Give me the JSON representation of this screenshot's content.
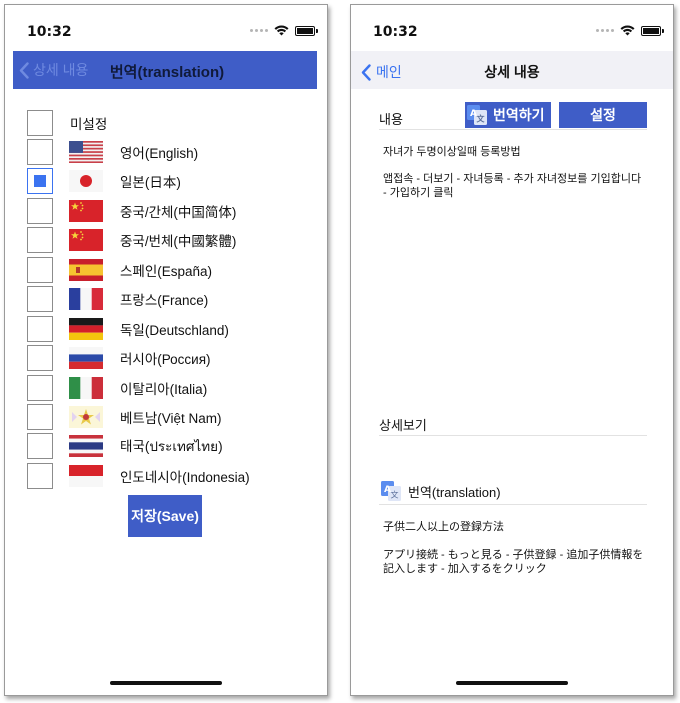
{
  "status_bar": {
    "time": "10:32"
  },
  "left_screen": {
    "nav": {
      "back_label": "상세 내용",
      "title": "번역(translation)"
    },
    "unset_label": "미설정",
    "languages": [
      {
        "label": "영어(English)",
        "flag": "us-flag",
        "checked": false
      },
      {
        "label": "일본(日本)",
        "flag": "japan-flag",
        "checked": true
      },
      {
        "label": "중국/간체(中国简体)",
        "flag": "china-flag",
        "checked": false
      },
      {
        "label": "중국/번체(中國繁體)",
        "flag": "china-flag",
        "checked": false
      },
      {
        "label": "스페인(España)",
        "flag": "spain-flag",
        "checked": false
      },
      {
        "label": "프랑스(France)",
        "flag": "france-flag",
        "checked": false
      },
      {
        "label": "독일(Deutschland)",
        "flag": "germany-flag",
        "checked": false
      },
      {
        "label": "러시아(Россия)",
        "flag": "russia-flag",
        "checked": false
      },
      {
        "label": "이탈리아(Italia)",
        "flag": "italy-flag",
        "checked": false
      },
      {
        "label": "베트남(Việt Nam)",
        "flag": "vietnam-flag",
        "checked": false
      },
      {
        "label": "태국(ประเทศไทย)",
        "flag": "thailand-flag",
        "checked": false
      },
      {
        "label": "인도네시아(Indonesia)",
        "flag": "indonesia-flag",
        "checked": false
      }
    ],
    "save_label": "저장(Save)"
  },
  "right_screen": {
    "nav": {
      "back_label": "메인",
      "title": "상세 내용"
    },
    "content_label": "내용",
    "translate_button": "번역하기",
    "settings_button": "설정",
    "content_title": "자녀가 두명이상일때 등록방법",
    "content_body": "앱접속 - 더보기 - 자녀등록 - 추가 자녀정보를 기입합니다 - 가입하기 클릭",
    "detail_label": "상세보기",
    "translation_header": "번역(translation)",
    "translation_title": "子供二人以上の登録方法",
    "translation_body": "アプリ接続 - もっと見る - 子供登録 - 追加子供情報を記入します - 加入するをクリック"
  },
  "colors": {
    "accent": "#3f5dc7",
    "link": "#3b73f0",
    "checked": "#3b73f0"
  }
}
